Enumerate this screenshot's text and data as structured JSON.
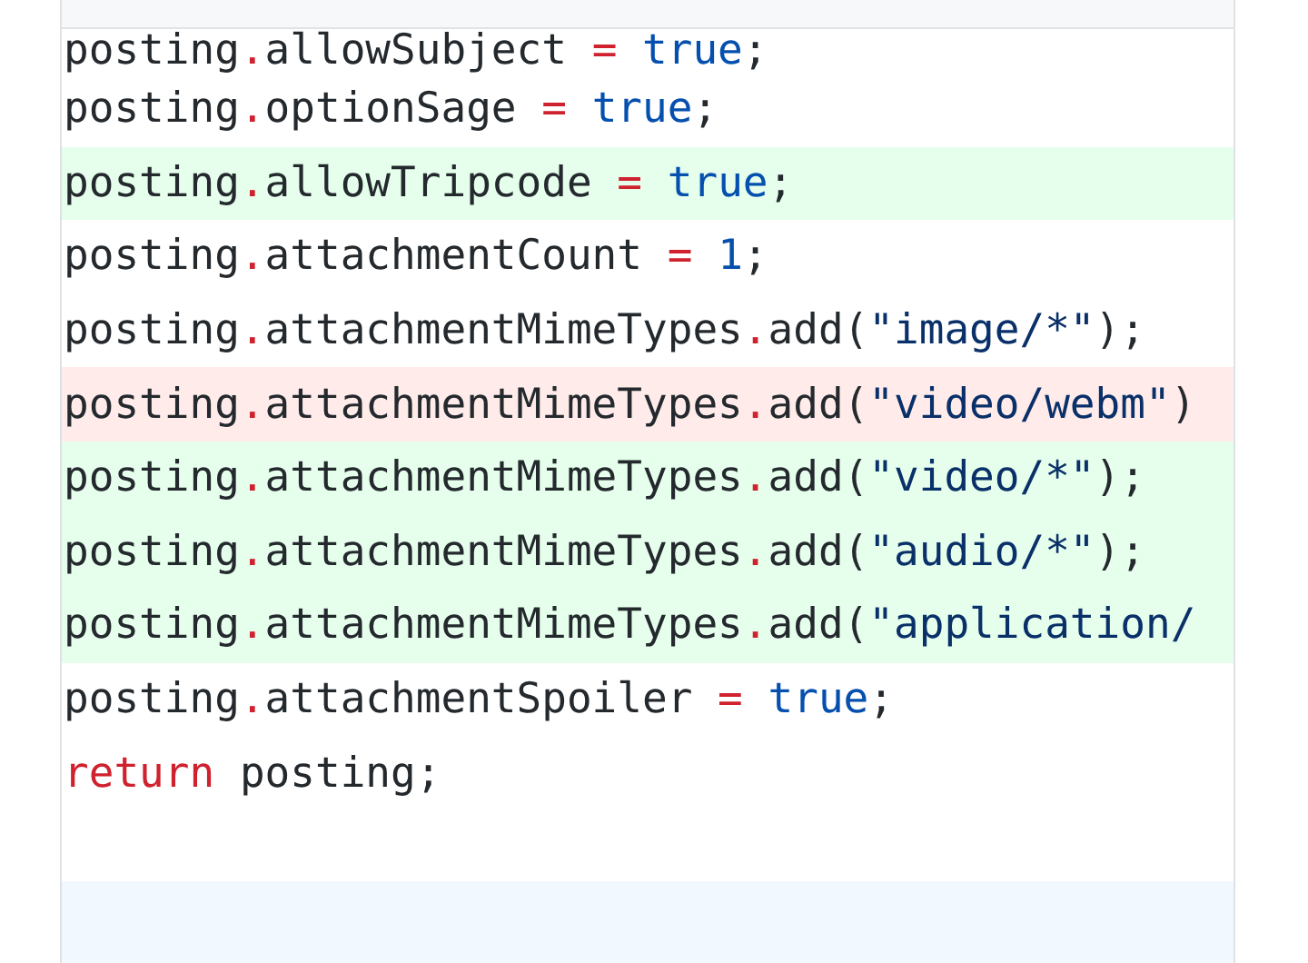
{
  "diff": {
    "lines": [
      {
        "added": false,
        "removed": false,
        "tokens": [
          {
            "kind": "plain",
            "text": "posting",
            "sep": "."
          },
          {
            "kind": "plain",
            "text": "allowSubject "
          },
          {
            "kind": "op",
            "text": "= "
          },
          {
            "kind": "literal",
            "text": "true"
          },
          {
            "kind": "plain",
            "text": ";"
          }
        ]
      },
      {
        "added": false,
        "removed": false,
        "tokens": [
          {
            "kind": "plain",
            "text": "posting",
            "sep": "."
          },
          {
            "kind": "plain",
            "text": "optionSage "
          },
          {
            "kind": "op",
            "text": "= "
          },
          {
            "kind": "literal",
            "text": "true"
          },
          {
            "kind": "plain",
            "text": ";"
          }
        ]
      },
      {
        "added": true,
        "removed": false,
        "tokens": [
          {
            "kind": "plain",
            "text": "posting",
            "sep": "."
          },
          {
            "kind": "plain",
            "text": "allowTripcode "
          },
          {
            "kind": "op",
            "text": "= "
          },
          {
            "kind": "literal",
            "text": "true"
          },
          {
            "kind": "plain",
            "text": ";"
          }
        ]
      },
      {
        "added": false,
        "removed": false,
        "tokens": [
          {
            "kind": "plain",
            "text": "posting",
            "sep": "."
          },
          {
            "kind": "plain",
            "text": "attachmentCount "
          },
          {
            "kind": "op",
            "text": "= "
          },
          {
            "kind": "literal",
            "text": "1"
          },
          {
            "kind": "plain",
            "text": ";"
          }
        ]
      },
      {
        "added": false,
        "removed": false,
        "tokens": [
          {
            "kind": "plain",
            "text": "posting",
            "sep": "."
          },
          {
            "kind": "plain",
            "text": "attachmentMimeTypes",
            "sep": "."
          },
          {
            "kind": "plain",
            "text": "add("
          },
          {
            "kind": "string",
            "text": "\"image/*\""
          },
          {
            "kind": "plain",
            "text": ");"
          }
        ]
      },
      {
        "added": false,
        "removed": true,
        "tokens": [
          {
            "kind": "plain",
            "text": "posting",
            "sep": "."
          },
          {
            "kind": "plain",
            "text": "attachmentMimeTypes",
            "sep": "."
          },
          {
            "kind": "plain",
            "text": "add("
          },
          {
            "kind": "string",
            "text": "\"video/webm\""
          },
          {
            "kind": "plain",
            "text": ")"
          }
        ]
      },
      {
        "added": true,
        "removed": false,
        "tokens": [
          {
            "kind": "plain",
            "text": "posting",
            "sep": "."
          },
          {
            "kind": "plain",
            "text": "attachmentMimeTypes",
            "sep": "."
          },
          {
            "kind": "plain",
            "text": "add("
          },
          {
            "kind": "string",
            "text": "\"video/*\""
          },
          {
            "kind": "plain",
            "text": ");"
          }
        ]
      },
      {
        "added": true,
        "removed": false,
        "tokens": [
          {
            "kind": "plain",
            "text": "posting",
            "sep": "."
          },
          {
            "kind": "plain",
            "text": "attachmentMimeTypes",
            "sep": "."
          },
          {
            "kind": "plain",
            "text": "add("
          },
          {
            "kind": "string",
            "text": "\"audio/*\""
          },
          {
            "kind": "plain",
            "text": ");"
          }
        ]
      },
      {
        "added": true,
        "removed": false,
        "tokens": [
          {
            "kind": "plain",
            "text": "posting",
            "sep": "."
          },
          {
            "kind": "plain",
            "text": "attachmentMimeTypes",
            "sep": "."
          },
          {
            "kind": "plain",
            "text": "add("
          },
          {
            "kind": "string",
            "text": "\"application/"
          }
        ]
      },
      {
        "added": false,
        "removed": false,
        "tokens": [
          {
            "kind": "plain",
            "text": "posting",
            "sep": "."
          },
          {
            "kind": "plain",
            "text": "attachmentSpoiler "
          },
          {
            "kind": "op",
            "text": "= "
          },
          {
            "kind": "literal",
            "text": "true"
          },
          {
            "kind": "plain",
            "text": ";"
          }
        ]
      },
      {
        "added": false,
        "removed": false,
        "tokens": [
          {
            "kind": "keyword",
            "text": "return"
          },
          {
            "kind": "plain",
            "text": " posting;"
          }
        ]
      }
    ]
  }
}
